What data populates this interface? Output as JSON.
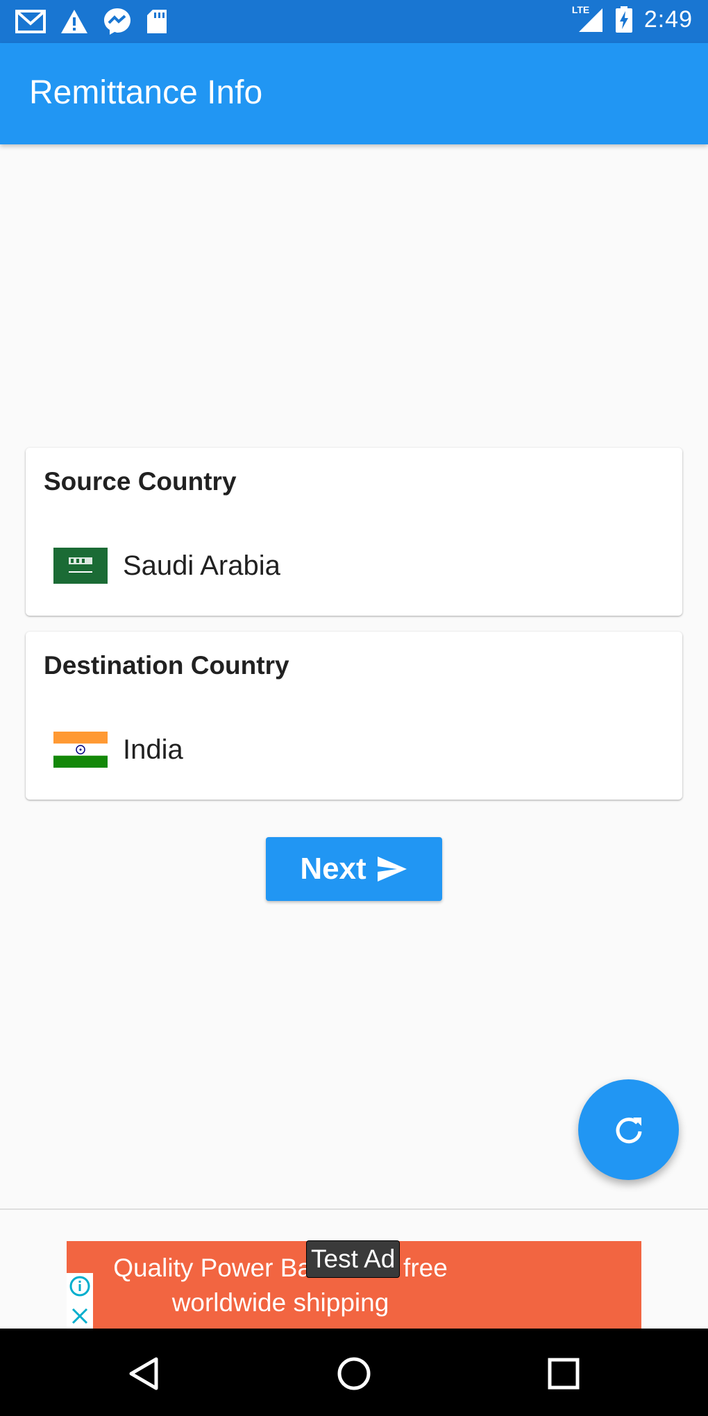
{
  "status_bar": {
    "time": "2:49",
    "network": "LTE",
    "left_icons": [
      "gmail-icon",
      "warning-icon",
      "messenger-icon",
      "sd-card-icon"
    ],
    "right_icons": [
      "signal-icon",
      "battery-charging-icon"
    ]
  },
  "app_bar": {
    "title": "Remittance Info"
  },
  "source_card": {
    "title": "Source Country",
    "country": "Saudi Arabia",
    "flag": "saudi-arabia-flag"
  },
  "destination_card": {
    "title": "Destination Country",
    "country": "India",
    "flag": "india-flag"
  },
  "next_button": {
    "label": "Next",
    "icon": "send-icon"
  },
  "fab": {
    "icon": "refresh-icon"
  },
  "ad": {
    "label": "Test Ad",
    "text_line1": "Quality Power Ba",
    "text_line1_end": "free",
    "text_line2": "worldwide shipping"
  },
  "nav_bar": {
    "icons": [
      "back-icon",
      "home-icon",
      "recents-icon"
    ]
  },
  "colors": {
    "primary": "#2196f3",
    "status_bar": "#1976d2",
    "ad_background": "#f26541",
    "background": "#fafafa"
  }
}
